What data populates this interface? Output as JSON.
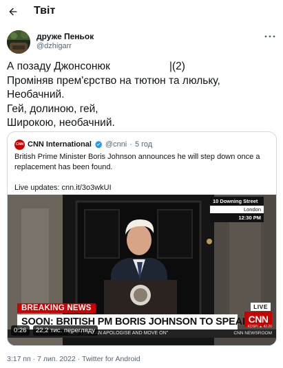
{
  "header": {
    "title": "Твіт",
    "back_icon": "arrow-left-icon"
  },
  "author": {
    "name": "друже Пеньок",
    "handle": "@dzhigarr",
    "more_icon": "more-horizontal-icon"
  },
  "tweet": {
    "text": "А позаду Джонсонюк                    |(2)\nПроміняв прем'єрство на тютюн та люльку,\nНеобачний.\nГей, долиною, гей,\nШирокою, необачний."
  },
  "quote": {
    "avatar_text": "CNN",
    "name": "CNN International",
    "verified_icon": "verified-badge-icon",
    "handle": "@cnni",
    "separator": "·",
    "time": "5 год",
    "body_line1": "British Prime Minister Boris Johnson announces he will step down once a replacement has been found.",
    "body_line2": "Live updates: cnn.it/3o3wkUI",
    "video": {
      "location_top": "10 Downing Street",
      "location_city": "London",
      "location_time": "12:30 PM",
      "breaking": "BREAKING NEWS",
      "headline": "SOON: BRITISH PM BORIS JOHNSON TO SPEAK",
      "live": "LIVE",
      "logo": "CNN",
      "ticker": "MES YOU CAN APOLOGISE AND MOVE ON\"",
      "newsroom": "CNN NEWSROOM",
      "kospi": "KOSPI ▲ 42.26",
      "duration": "0:26",
      "views": "22,2 тис. перегляду"
    }
  },
  "meta": {
    "timestamp": "3:17 пп · 7 лип. 2022 · Twitter for Android"
  },
  "colors": {
    "accent": "#1d9bf0",
    "cnn_red": "#cc0000",
    "secondary_text": "#536471"
  }
}
